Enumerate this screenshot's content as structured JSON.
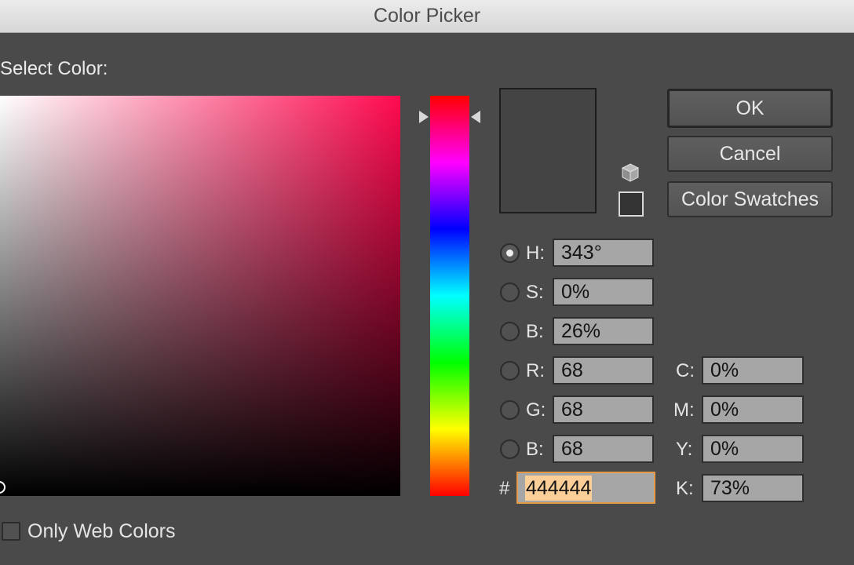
{
  "window": {
    "title": "Color Picker"
  },
  "picker": {
    "select_label": "Select Color:"
  },
  "buttons": {
    "ok": "OK",
    "cancel": "Cancel",
    "swatches": "Color Swatches"
  },
  "hsb": {
    "h": {
      "label": "H:",
      "value": "343°"
    },
    "s": {
      "label": "S:",
      "value": "0%"
    },
    "b": {
      "label": "B:",
      "value": "26%"
    }
  },
  "rgb": {
    "r": {
      "label": "R:",
      "value": "68"
    },
    "g": {
      "label": "G:",
      "value": "68"
    },
    "b": {
      "label": "B:",
      "value": "68"
    }
  },
  "cmyk": {
    "c": {
      "label": "C:",
      "value": "0%"
    },
    "m": {
      "label": "M:",
      "value": "0%"
    },
    "y": {
      "label": "Y:",
      "value": "0%"
    },
    "k": {
      "label": "K:",
      "value": "73%"
    }
  },
  "hex": {
    "label": "#",
    "value": "444444"
  },
  "web_colors": {
    "label": "Only Web Colors",
    "checked": false
  },
  "colors": {
    "current": "#444444",
    "web_safe": "#333333",
    "hue_accent": "#ff0a50"
  },
  "icons": {
    "websafe_warning": "cube-icon"
  }
}
